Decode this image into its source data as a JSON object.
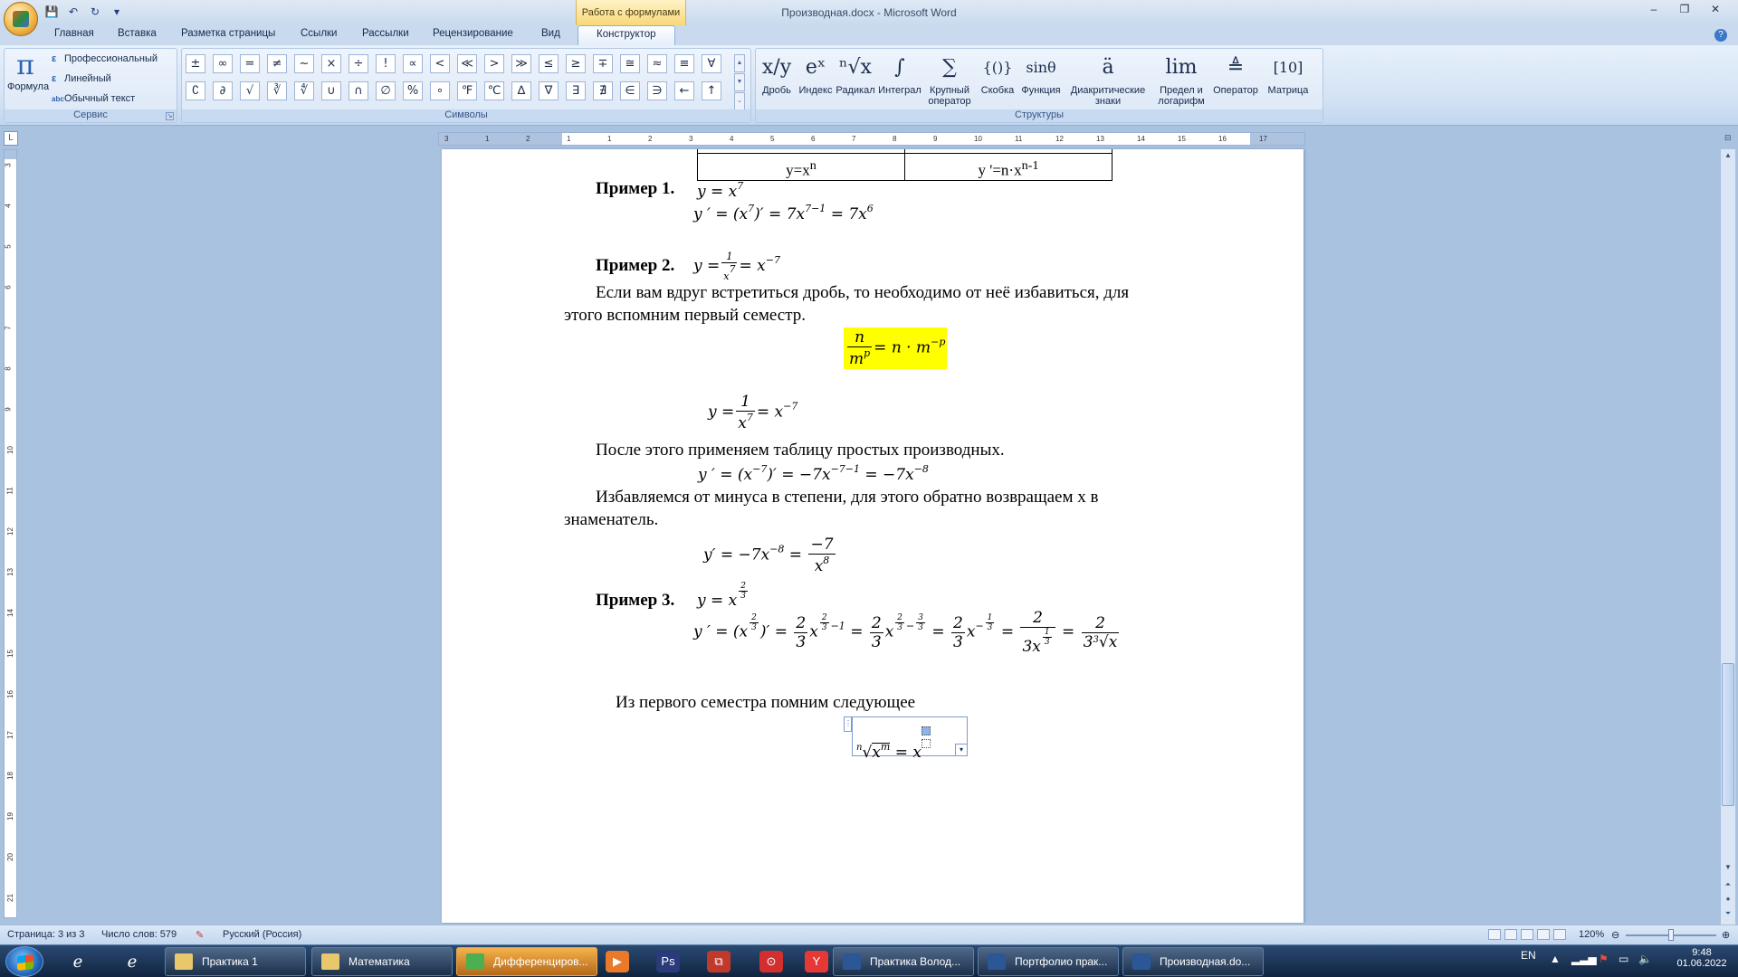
{
  "window": {
    "doc_title": "Производная.docx - Microsoft Word",
    "context_tab_group": "Работа с формулами"
  },
  "qat": [
    "save",
    "undo",
    "redo",
    "customize"
  ],
  "tabs": [
    "Главная",
    "Вставка",
    "Разметка страницы",
    "Ссылки",
    "Рассылки",
    "Рецензирование",
    "Вид",
    "Конструктор"
  ],
  "active_tab": "Конструктор",
  "ribbon": {
    "service": {
      "formula_label": "Формула",
      "opt1": "Профессиональный",
      "opt2": "Линейный",
      "opt3": "Обычный текст",
      "group_label": "Сервис"
    },
    "symbols": {
      "row1": [
        "±",
        "∞",
        "=",
        "≠",
        "~",
        "×",
        "÷",
        "!",
        "∝",
        "<",
        "≪",
        ">",
        "≫",
        "≤",
        "≥",
        "∓",
        "≅",
        "≈",
        "≡",
        "∀"
      ],
      "row2": [
        "∁",
        "∂",
        "√",
        "∛",
        "∜",
        "∪",
        "∩",
        "∅",
        "%",
        "∘",
        "℉",
        "℃",
        "∆",
        "∇",
        "∃",
        "∄",
        "∈",
        "∋",
        "←",
        "↑"
      ],
      "group_label": "Символы"
    },
    "structures": {
      "items": [
        {
          "glyph": "x/y",
          "label": "Дробь",
          "label2": ""
        },
        {
          "glyph": "eˣ",
          "label": "Индекс",
          "label2": ""
        },
        {
          "glyph": "ⁿ√x",
          "label": "Радикал",
          "label2": ""
        },
        {
          "glyph": "∫",
          "label": "Интеграл",
          "label2": ""
        },
        {
          "glyph": "∑",
          "label": "Крупный",
          "label2": "оператор"
        },
        {
          "glyph": "{()}",
          "label": "Скобка",
          "label2": ""
        },
        {
          "glyph": "sinθ",
          "label": "Функция",
          "label2": ""
        },
        {
          "glyph": "ä",
          "label": "Диакритические",
          "label2": "знаки"
        },
        {
          "glyph": "lim",
          "label": "Предел и",
          "label2": "логарифм"
        },
        {
          "glyph": "≜",
          "label": "Оператор",
          "label2": ""
        },
        {
          "glyph": "[10]",
          "label": "Матрица",
          "label2": ""
        }
      ],
      "group_label": "Структуры"
    }
  },
  "ruler": {
    "h_ticks": [
      "3",
      "1",
      "2",
      "1",
      "1",
      "2",
      "3",
      "4",
      "5",
      "6",
      "7",
      "8",
      "9",
      "10",
      "11",
      "12",
      "13",
      "14",
      "15",
      "16",
      "17"
    ],
    "v_ticks": [
      "3",
      "4",
      "5",
      "6",
      "7",
      "8",
      "9",
      "10",
      "11",
      "12",
      "13",
      "14",
      "15",
      "16",
      "17",
      "18",
      "19",
      "20",
      "21"
    ]
  },
  "document": {
    "table": {
      "c1": "y=x",
      "c1sup": "n",
      "c2": "y '=n·x",
      "c2sup": "n-1"
    },
    "ex1_label": "Пример 1.",
    "ex1_eq": "y = x",
    "ex1_eq_sup": "7",
    "ex1_deriv_a": "y ′ = (x",
    "ex1_deriv_b": ")′ = 7x",
    "ex1_deriv_c": " = 7x",
    "ex1_sup1": "7",
    "ex1_sup2": "7−1",
    "ex1_sup3": "6",
    "ex2_label": "Пример 2.",
    "p1": "Если вам вдруг встретиться дробь, то необходимо от неё избавиться, для",
    "p1b": "этого вспомним первый семестр.",
    "rule": {
      "num": "n",
      "den": "m",
      "den_sup": "p",
      "rhs": "= n · m",
      "rhs_sup": "−p"
    },
    "eq_frac": {
      "lhs": "y =",
      "num": "1",
      "den": "x",
      "den_sup": "7",
      "rhs": "= x",
      "rhs_sup": "−7"
    },
    "p2": "После этого применяем таблицу простых производных.",
    "deriv2": "y ′ = (x",
    "deriv2_b": ")′ = −7x",
    "deriv2_c": " = −7x",
    "deriv2_sup1": "−7",
    "deriv2_sup2": "−7−1",
    "deriv2_sup3": "−8",
    "p3": "Избавляемся от минуса в степени, для этого обратно возвращаем x в",
    "p3b": "знаменатель.",
    "deriv3": {
      "lhs": "y′ = −7x",
      "lhs_sup": "−8",
      "eq": "=",
      "num": "−7",
      "den": "x",
      "den_sup": "8"
    },
    "ex3_label": "Пример 3.",
    "ex3_eq": "y = x",
    "ex3_frac": {
      "num": "2",
      "den": "3"
    },
    "ex3_deriv": {
      "lhs": "y ′ = (x",
      "close": ")′ =",
      "two": "2",
      "three": "3",
      "minus_one": "−1",
      "minus": "−",
      "neg": "−",
      "one": "1",
      "x": "x",
      "eq": "=",
      "den_last": "3",
      "radicand": "x"
    },
    "p4": "Из первого семестра помним следующее",
    "root_eq": {
      "index": "n",
      "radicand": "x",
      "rad_sup": "m",
      "rhs": "= x"
    }
  },
  "status": {
    "page": "Страница: 3 из 3",
    "words": "Число слов: 579",
    "lang": "Русский (Россия)",
    "zoom": "120%",
    "zoom_level": 0.5
  },
  "taskbar": {
    "items": [
      {
        "label": "Практика 1",
        "color": "#e8c86a"
      },
      {
        "label": "Математика",
        "color": "#e8c86a"
      },
      {
        "label": "Дифференциров...",
        "color": "#4caf50"
      },
      {
        "label": "Практика Волод...",
        "color": "#2b5797"
      },
      {
        "label": "Портфолио прак...",
        "color": "#2b5797"
      },
      {
        "label": "Производная.do...",
        "color": "#2b5797"
      }
    ],
    "pinned": [
      "ie-icon",
      "media-icon",
      "photoshop-icon",
      "acrobat-icon",
      "yandex-icon"
    ],
    "lang": "EN",
    "time": "9:48",
    "date": "01.06.2022"
  }
}
